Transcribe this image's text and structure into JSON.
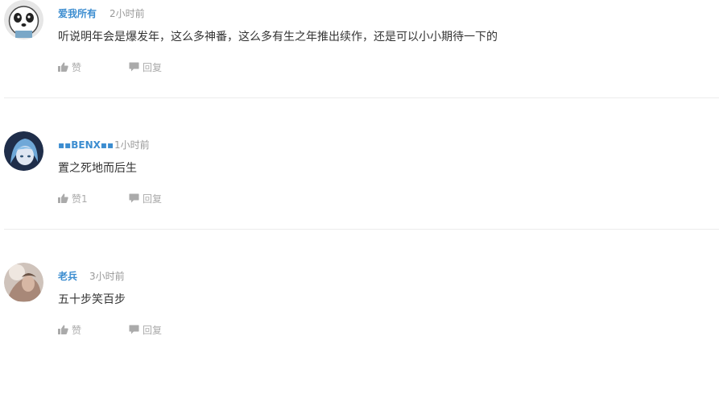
{
  "comments": [
    {
      "username": "爱我所有",
      "time": "2小时前",
      "text": "听说明年会是爆发年，这么多神番，这么多有生之年推出续作，还是可以小小期待一下的",
      "like_label": "赞",
      "reply_label": "回复"
    },
    {
      "username": "▪▪BENX▪▪",
      "time": "1小时前",
      "text": "置之死地而后生",
      "like_label": "赞1",
      "reply_label": "回复"
    },
    {
      "username": "老兵",
      "time": "3小时前",
      "text": "五十步笑百步",
      "like_label": "赞",
      "reply_label": "回复"
    }
  ],
  "icons": {
    "like": "thumbs-up-icon",
    "reply": "speech-bubble-icon"
  },
  "colors": {
    "username": "#3c8dd0",
    "meta": "#999999",
    "action": "#aaaaaa",
    "divider": "#ececec"
  }
}
